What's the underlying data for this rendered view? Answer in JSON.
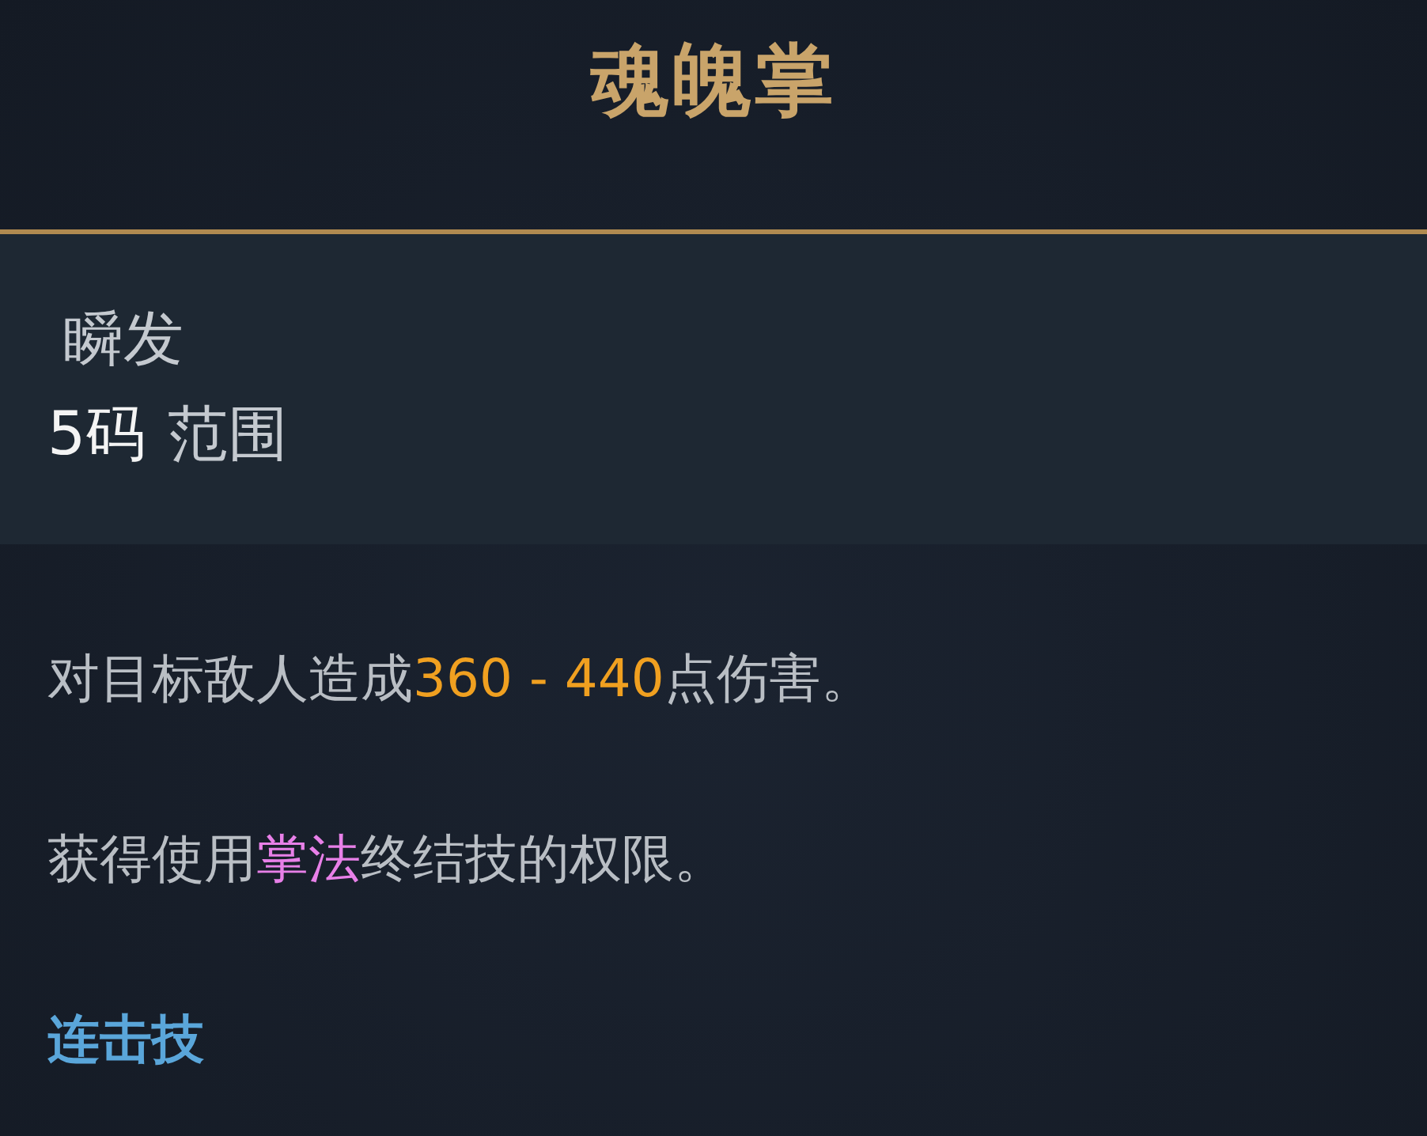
{
  "title": "魂魄掌",
  "cast": "瞬发",
  "range": {
    "value": "5码",
    "label": "范围"
  },
  "description": [
    {
      "segments": [
        {
          "text": "对目标敌人造成",
          "kind": "plain"
        },
        {
          "text": "360 - 440",
          "kind": "number"
        },
        {
          "text": "点伤害。",
          "kind": "plain"
        }
      ]
    },
    {
      "segments": [
        {
          "text": "获得使用",
          "kind": "plain"
        },
        {
          "text": "掌法",
          "kind": "keyword"
        },
        {
          "text": "终结技的权限。",
          "kind": "plain"
        }
      ]
    }
  ],
  "tag": "连击技"
}
